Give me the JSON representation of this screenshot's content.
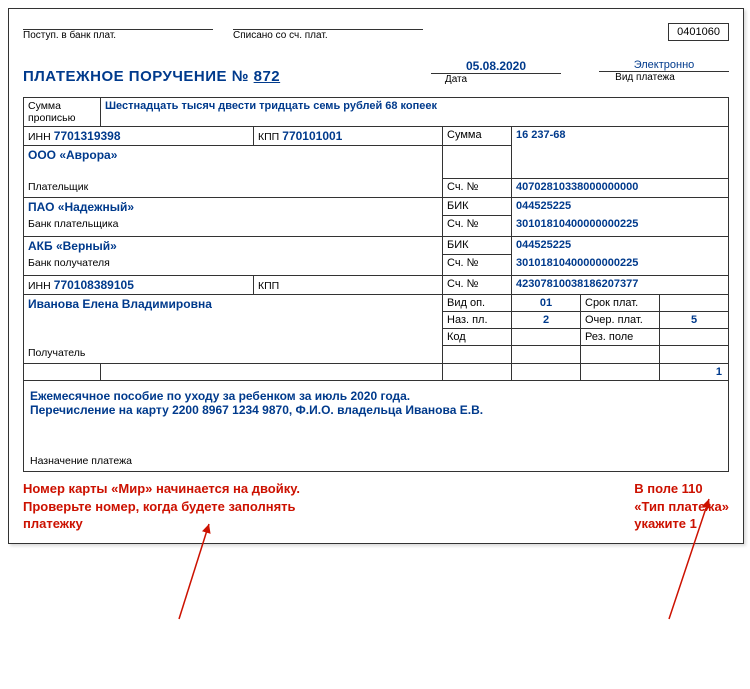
{
  "form_code": "0401060",
  "top": {
    "postup_lbl": "Поступ. в банк плат.",
    "spisano_lbl": "Списано со сч. плат."
  },
  "title_text": "ПЛАТЕЖНОЕ ПОРУЧЕНИЕ №",
  "number": "872",
  "date": "05.08.2020",
  "date_lbl": "Дата",
  "pay_type": "Электронно",
  "pay_type_lbl": "Вид платежа",
  "sum_words_lbl": "Сумма\nпрописью",
  "sum_words": "Шестнадцать тысяч двести тридцать семь рублей 68 копеек",
  "payer": {
    "inn_lbl": "ИНН",
    "inn": "7701319398",
    "kpp_lbl": "КПП",
    "kpp": "770101001",
    "name": "ООО «Аврора»",
    "sect": "Плательщик"
  },
  "payer_bank": {
    "name": "ПАО «Надежный»",
    "sect": "Банк плательщика"
  },
  "recip_bank": {
    "name": "АКБ «Верный»",
    "sect": "Банк получателя"
  },
  "recipient": {
    "inn_lbl": "ИНН",
    "inn": "770108389105",
    "kpp_lbl": "КПП",
    "kpp": "",
    "name": "Иванова Елена Владимировна",
    "sect": "Получатель"
  },
  "right": {
    "sum_lbl": "Сумма",
    "sum": "16 237-68",
    "acc_lbl": "Сч. №",
    "payer_acc": "40702810338000000000",
    "bik_lbl": "БИК",
    "payer_bank_bik": "044525225",
    "payer_bank_acc": "30101810400000000225",
    "recip_bank_bik": "044525225",
    "recip_bank_acc": "30101810400000000225",
    "recip_acc": "42307810038186207377",
    "vid_op_lbl": "Вид оп.",
    "vid_op": "01",
    "srok_lbl": "Срок плат.",
    "naz_pl_lbl": "Наз. пл.",
    "naz_pl": "2",
    "ocher_lbl": "Очер. плат.",
    "ocher": "5",
    "kod_lbl": "Код",
    "rez_lbl": "Рез. поле",
    "field_110": "1"
  },
  "purpose_lbl": "Назначение платежа",
  "purpose_line1": "Ежемесячное пособие по уходу за ребенком за июль 2020 года.",
  "purpose_line2": "Перечисление на карту 2200 8967 1234 9870,  Ф.И.О. владельца Иванова Е.В.",
  "note_left": "Номер карты «Мир» начинается на двойку.\nПроверьте номер, когда будете заполнять\nплатежку",
  "note_right": "В поле 110\n«Тип платежа»\nукажите 1"
}
